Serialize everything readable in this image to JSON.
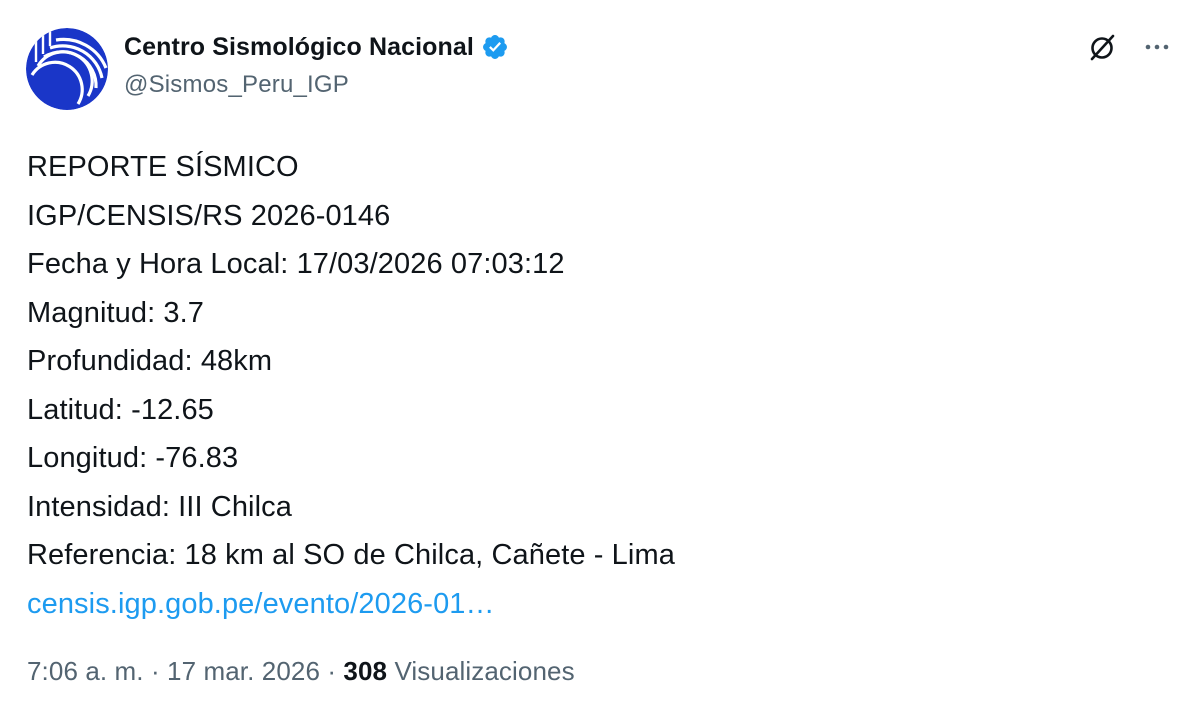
{
  "author": {
    "display_name": "Centro Sismológico Nacional",
    "handle": "@Sismos_Peru_IGP",
    "verified": true,
    "avatar_colors": {
      "primary": "#1a36c8",
      "background": "#ffffff"
    }
  },
  "icons": {
    "verified": "verified-badge-icon",
    "grok": "grok-icon",
    "more": "more-options-icon"
  },
  "colors": {
    "text": "#0f1419",
    "secondary": "#536471",
    "link": "#1d9bf0",
    "verified": "#1d9bf0"
  },
  "tweet": {
    "lines": [
      "REPORTE SÍSMICO",
      "IGP/CENSIS/RS 2026-0146",
      "Fecha y Hora Local: 17/03/2026 07:03:12",
      "Magnitud: 3.7",
      "Profundidad: 48km",
      "Latitud: -12.65",
      "Longitud: -76.83",
      "Intensidad: III Chilca",
      "Referencia: 18 km al SO de Chilca, Cañete - Lima"
    ],
    "link_text": "censis.igp.gob.pe/evento/2026-01…"
  },
  "meta": {
    "time": "7:06 a. m.",
    "separator": " · ",
    "date": "17 mar. 2026",
    "views_count": "308",
    "views_label": "Visualizaciones"
  }
}
